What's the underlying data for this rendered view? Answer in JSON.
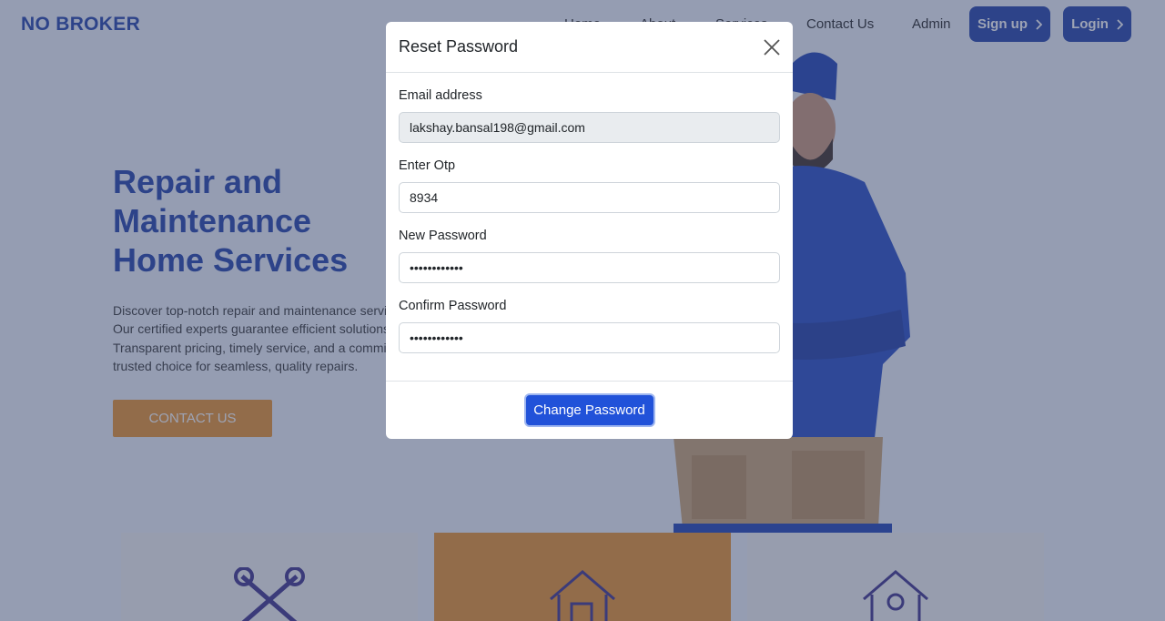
{
  "header": {
    "logo": "NO BROKER",
    "nav": {
      "home": "Home",
      "about": "About",
      "services": "Services",
      "contact": "Contact Us",
      "admin": "Admin"
    },
    "signup_label": "Sign up",
    "login_label": "Login"
  },
  "hero": {
    "title_lines": [
      "Repair and",
      "Maintenance",
      "Home Services"
    ],
    "text_lines": [
      "Discover top-notch repair and maintenance services.",
      "Our certified experts guarantee efficient solutions,",
      "Transparent pricing, timely service, and a commitment",
      "trusted choice for seamless, quality repairs."
    ],
    "button_label": "CONTACT US"
  },
  "modal": {
    "title": "Reset Password",
    "email_label": "Email address",
    "email_value": "lakshay.bansal198@gmail.com",
    "otp_label": "Enter Otp",
    "otp_value": "8934",
    "new_password_label": "New Password",
    "new_password_value": "••••••••••••",
    "confirm_password_label": "Confirm Password",
    "confirm_password_value": "••••••••••••",
    "submit_label": "Change Password"
  },
  "colors": {
    "brand": "#1e3fa8",
    "accent": "#e8912a",
    "primary_button": "#2152d9"
  }
}
